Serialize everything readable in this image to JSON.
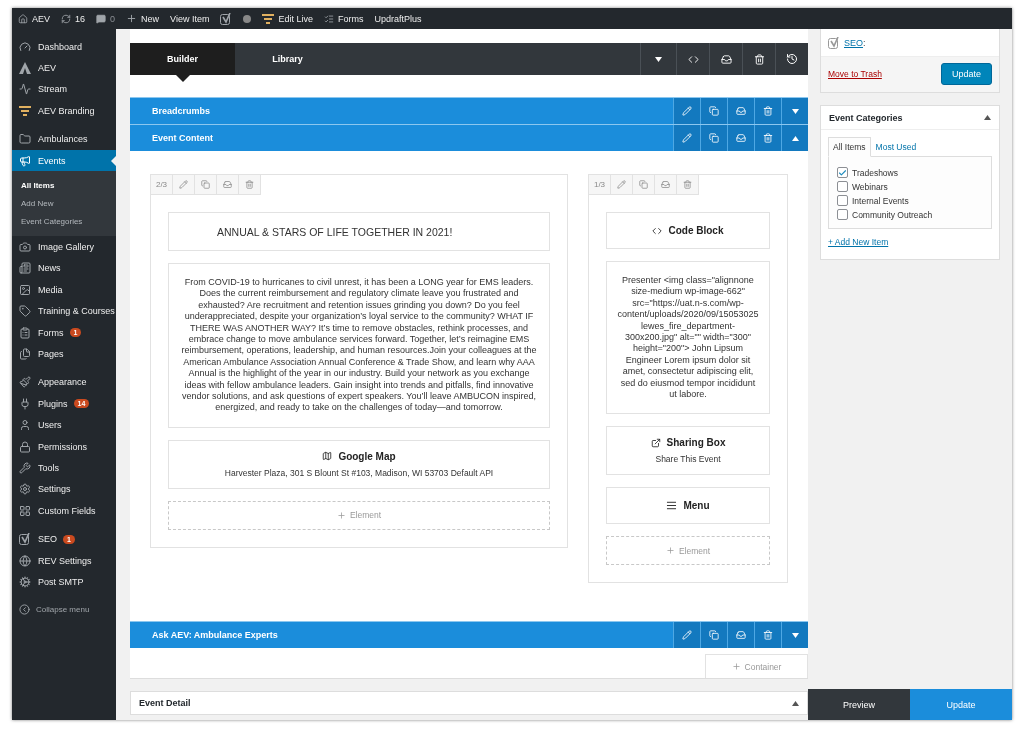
{
  "admin_bar": [
    {
      "kind": "home",
      "label": "AEV"
    },
    {
      "kind": "updates",
      "label": "16"
    },
    {
      "kind": "comments",
      "label": "0"
    },
    {
      "kind": "new",
      "label": "New"
    },
    {
      "kind": "link",
      "label": "View Item"
    },
    {
      "kind": "yoast"
    },
    {
      "kind": "status"
    },
    {
      "kind": "edit_live",
      "label": "Edit Live"
    },
    {
      "kind": "forms",
      "label": "Forms"
    },
    {
      "kind": "link",
      "label": "UpdraftPlus"
    }
  ],
  "sidebar": {
    "groups": [
      [
        {
          "label": "Dashboard",
          "selected": false
        },
        {
          "label": "AEV",
          "selected": false
        },
        {
          "label": "Stream",
          "selected": false
        },
        {
          "label": "AEV Branding",
          "selected": false
        }
      ],
      [
        {
          "label": "Ambulances",
          "selected": false
        },
        {
          "label": "Events",
          "selected": true,
          "children": [
            {
              "label": "All Items",
              "selected": true
            },
            {
              "label": "Add New",
              "selected": false
            },
            {
              "label": "Event Categories",
              "selected": false
            }
          ]
        },
        {
          "label": "Image Gallery",
          "selected": false
        },
        {
          "label": "News",
          "selected": false
        },
        {
          "label": "Media",
          "selected": false
        },
        {
          "label": "Training & Courses",
          "selected": false
        },
        {
          "label": "Forms",
          "selected": false,
          "badge": "1"
        },
        {
          "label": "Pages",
          "selected": false
        }
      ],
      [
        {
          "label": "Appearance",
          "selected": false
        },
        {
          "label": "Plugins",
          "selected": false,
          "badge": "14"
        },
        {
          "label": "Users",
          "selected": false
        },
        {
          "label": "Permissions",
          "selected": false
        },
        {
          "label": "Tools",
          "selected": false
        },
        {
          "label": "Settings",
          "selected": false
        },
        {
          "label": "Custom Fields",
          "selected": false
        }
      ],
      [
        {
          "label": "SEO",
          "selected": false,
          "badge": "1"
        },
        {
          "label": "REV Settings",
          "selected": false
        },
        {
          "label": "Post SMTP",
          "selected": false
        }
      ]
    ],
    "collapse": "Collapse menu"
  },
  "builder": {
    "tabs": [
      {
        "label": "Builder",
        "selected": true
      },
      {
        "label": "Library",
        "selected": false
      }
    ],
    "sections": [
      {
        "title": "Breadcrumbs",
        "expanded": false
      },
      {
        "title": "Event Content",
        "expanded": true,
        "columns": [
          {
            "fraction": "2/3",
            "elements": [
              {
                "kind": "heading",
                "text": "ANNUAL & STARS OF LIFE TOGETHER IN 2021!"
              },
              {
                "kind": "text",
                "text": "From COVID-19 to hurricanes to civil unrest, it has been a LONG year for EMS leaders. Does the current reimbursement and regulatory climate leave you frustrated and exhausted? Are recruitment and retention issues grinding you down? Do you feel underappreciated, despite your organization’s loyal service to the community? WHAT IF THERE WAS ANOTHER WAY? It’s time to remove obstacles, rethink processes, and embrace change to move ambulance services forward. Together, let’s reimagine EMS reimbursement, operations, leadership, and human resources.Join your colleagues at the American Ambulance Association Annual Conference & Trade Show, and learn why AAA Annual is the highlight of the year in our industry. Build your network as you exchange ideas with fellow ambulance leaders. Gain insight into trends and pitfalls, find innovative vendor solutions, and ask questions of expert speakers. You’ll leave AMBUCON inspired, energized, and ready to take on the challenges of today—and tomorrow."
              },
              {
                "kind": "map",
                "title": "Google Map",
                "subtitle": "Harvester Plaza, 301 S Blount St #103, Madison, WI 53703 Default API"
              },
              {
                "kind": "add",
                "label": "Element"
              }
            ]
          },
          {
            "fraction": "1/3",
            "elements": [
              {
                "kind": "code",
                "title": "Code Block"
              },
              {
                "kind": "text",
                "text": "Presenter <img class=\"alignnone size-medium wp-image-662\" src=\"https://uat.n-s.com/wp-content/uploads/2020/09/15053025 lewes_fire_department-300x200.jpg\" alt=\"\" width=\"300\" height=\"200\"> John Lipsum Engineer Lorem ipsum dolor sit amet, consectetur adipiscing elit, sed do eiusmod tempor incididunt ut labore."
              },
              {
                "kind": "share",
                "title": "Sharing Box",
                "subtitle": "Share This Event"
              },
              {
                "kind": "menu",
                "title": "Menu"
              },
              {
                "kind": "add",
                "label": "Element"
              }
            ]
          }
        ]
      },
      {
        "title": "Ask AEV: Ambulance Experts",
        "expanded": false
      }
    ],
    "add_container": "Container"
  },
  "event_detail": {
    "title": "Event Detail",
    "expanded": true
  },
  "publish": {
    "seo_link": "SEO",
    "seo_suffix": ":",
    "trash": "Move to Trash",
    "update": "Update"
  },
  "categories": {
    "title": "Event Categories",
    "tabs": [
      {
        "label": "All Items",
        "selected": true
      },
      {
        "label": "Most Used",
        "selected": false
      }
    ],
    "items": [
      {
        "label": "Tradeshows",
        "checked": true
      },
      {
        "label": "Webinars",
        "checked": false
      },
      {
        "label": "Internal Events",
        "checked": false
      },
      {
        "label": "Community Outreach",
        "checked": false
      }
    ],
    "add_new": "+ Add New Item"
  },
  "footer_bar": {
    "preview": "Preview",
    "update": "Update"
  }
}
